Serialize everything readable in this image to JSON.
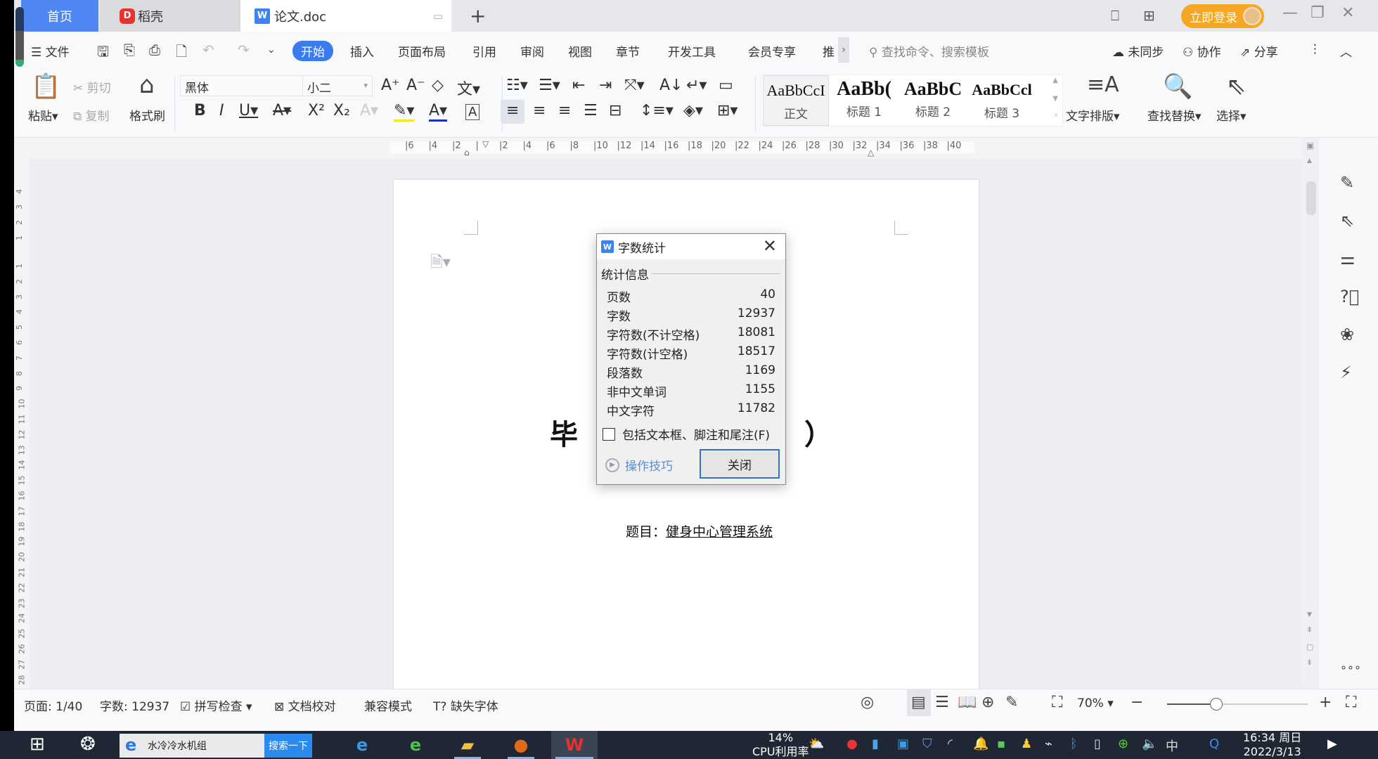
{
  "tabs": {
    "home": "首页",
    "daoke": "稻壳",
    "doc": "论文.doc",
    "add": "+"
  },
  "titlebar": {
    "login": "立即登录",
    "minimize": "—",
    "restore": "❐",
    "close": "✕"
  },
  "menu": {
    "file": "文件",
    "items": [
      "开始",
      "插入",
      "页面布局",
      "引用",
      "审阅",
      "视图",
      "章节",
      "开发工具",
      "会员专享",
      "推"
    ],
    "active": "开始",
    "search_placeholder": "查找命令、搜索模板",
    "sync": "未同步",
    "collab": "协作",
    "share": "分享"
  },
  "ribbon": {
    "paste": "粘贴",
    "cut": "剪切",
    "copy": "复制",
    "format_painter": "格式刷",
    "font_name": "黑体",
    "font_size": "小二",
    "styles": [
      {
        "preview": "AaBbCcI",
        "label": "正文"
      },
      {
        "preview": "AaBb(",
        "label": "标题 1"
      },
      {
        "preview": "AaBbC",
        "label": "标题 2"
      },
      {
        "preview": "AaBbCcl",
        "label": "标题 3"
      }
    ],
    "text_layout": "文字排版",
    "find_replace": "查找替换",
    "select": "选择"
  },
  "ruler": {
    "h_ticks": [
      "6",
      "4",
      "2",
      "",
      "2",
      "4",
      "6",
      "8",
      "10",
      "12",
      "14",
      "16",
      "18",
      "20",
      "22",
      "24",
      "26",
      "28",
      "30",
      "32",
      "34",
      "36",
      "38",
      "40"
    ],
    "v_ticks_top": [
      "4",
      "3",
      "2",
      "1"
    ],
    "v_ticks": [
      "1",
      "2",
      "3",
      "4",
      "5",
      "6",
      "7",
      "8",
      "9",
      "10",
      "11",
      "12",
      "13",
      "14",
      "15",
      "16",
      "17",
      "18",
      "19",
      "20",
      "21",
      "22",
      "23",
      "24",
      "25",
      "26",
      "27",
      "28"
    ]
  },
  "document": {
    "title_visible": "毕 业",
    "title_tail": "）",
    "subject_label": "题目：",
    "subject_value": "健身中心管理系统"
  },
  "dialog": {
    "title": "字数统计",
    "section": "统计信息",
    "rows": [
      {
        "label": "页数",
        "value": "40"
      },
      {
        "label": "字数",
        "value": "12937"
      },
      {
        "label": "字符数(不计空格)",
        "value": "18081"
      },
      {
        "label": "字符数(计空格)",
        "value": "18517"
      },
      {
        "label": "段落数",
        "value": "1169"
      },
      {
        "label": "非中文单词",
        "value": "1155"
      },
      {
        "label": "中文字符",
        "value": "11782"
      }
    ],
    "include_checkbox": "包括文本框、脚注和尾注(F)",
    "include_checked": false,
    "tips": "操作技巧",
    "close_button": "关闭"
  },
  "statusbar": {
    "page": "页面: 1/40",
    "words": "字数: 12937",
    "spell": "拼写检查",
    "proof": "文档校对",
    "compat": "兼容模式",
    "missing_font": "缺失字体",
    "zoom": "70%",
    "zoom_fraction": 0.35
  },
  "taskbar": {
    "search_text": "水冷冷水机组",
    "search_button": "搜索一下",
    "cpu_percent": "14%",
    "cpu_label": "CPU利用率",
    "ime": "中",
    "time": "16:34 周日",
    "date": "2022/3/13"
  }
}
